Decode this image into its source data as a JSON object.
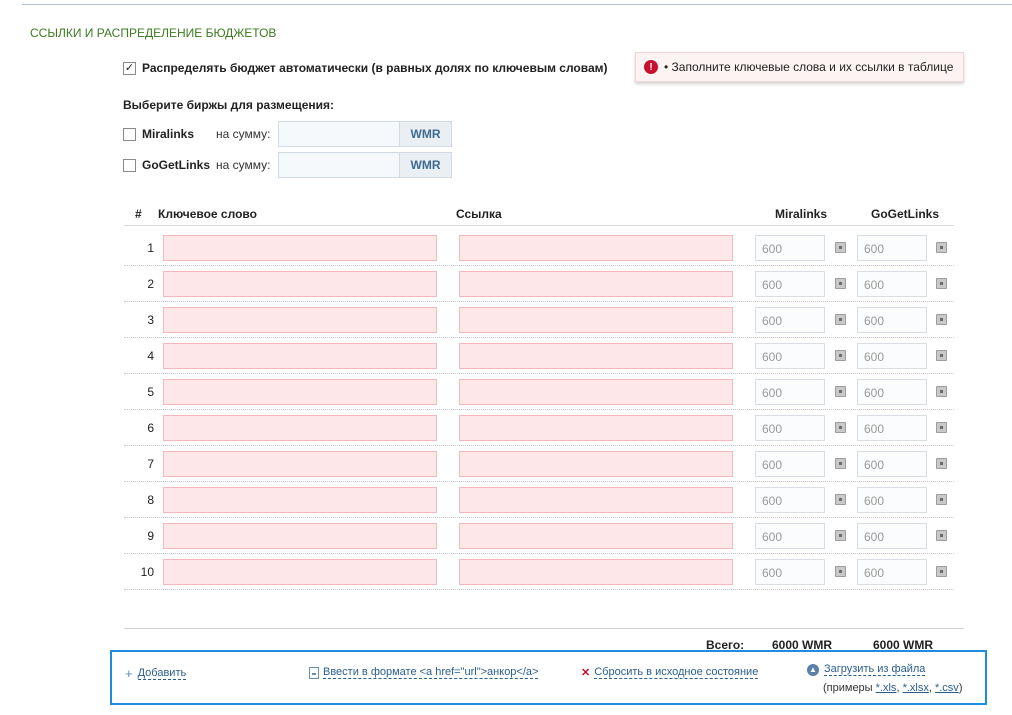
{
  "section": {
    "title": "ССЫЛКИ И РАСПРЕДЕЛЕНИЕ БЮДЖЕТОВ"
  },
  "auto_distribute": {
    "label": "Распределять бюджет автоматически (в равных долях по ключевым словам)",
    "checked": true,
    "check_glyph": "✓"
  },
  "alert": {
    "icon": "!",
    "text": "• Заполните ключевые слова и их ссылки в таблице"
  },
  "exchanges": {
    "title": "Выберите биржы для размещения:",
    "items": [
      {
        "name": "Miralinks",
        "sum_label": "на сумму:",
        "currency": "WMR",
        "value": ""
      },
      {
        "name": "GoGetLinks",
        "sum_label": "на сумму:",
        "currency": "WMR",
        "value": ""
      }
    ]
  },
  "table": {
    "headers": {
      "num": "#",
      "keyword": "Ключевое слово",
      "link": "Ссылка",
      "miralinks": "Miralinks",
      "gogetlinks": "GoGetLinks"
    },
    "rows": [
      {
        "num": "1",
        "keyword": "",
        "link": "",
        "miralinks": "600",
        "gogetlinks": "600"
      },
      {
        "num": "2",
        "keyword": "",
        "link": "",
        "miralinks": "600",
        "gogetlinks": "600"
      },
      {
        "num": "3",
        "keyword": "",
        "link": "",
        "miralinks": "600",
        "gogetlinks": "600"
      },
      {
        "num": "4",
        "keyword": "",
        "link": "",
        "miralinks": "600",
        "gogetlinks": "600"
      },
      {
        "num": "5",
        "keyword": "",
        "link": "",
        "miralinks": "600",
        "gogetlinks": "600"
      },
      {
        "num": "6",
        "keyword": "",
        "link": "",
        "miralinks": "600",
        "gogetlinks": "600"
      },
      {
        "num": "7",
        "keyword": "",
        "link": "",
        "miralinks": "600",
        "gogetlinks": "600"
      },
      {
        "num": "8",
        "keyword": "",
        "link": "",
        "miralinks": "600",
        "gogetlinks": "600"
      },
      {
        "num": "9",
        "keyword": "",
        "link": "",
        "miralinks": "600",
        "gogetlinks": "600"
      },
      {
        "num": "10",
        "keyword": "",
        "link": "",
        "miralinks": "600",
        "gogetlinks": "600"
      }
    ],
    "totals": {
      "label": "Всего:",
      "miralinks": "6000 WMR",
      "gogetlinks": "6000 WMR"
    }
  },
  "actions": {
    "add": "Добавить",
    "enter_format": "Ввести в формате <a href=\"url\">анкор</a>",
    "reset": "Сбросить в исходное состояние",
    "upload": "Загрузить из файла",
    "examples_prefix": "(примеры",
    "examples": [
      "*.xls",
      "*.xlsx",
      "*.csv"
    ],
    "examples_suffix": ")"
  },
  "colors": {
    "section_title": "#3b7a20",
    "alert_icon": "#c8102e",
    "action_link": "#2a5d8e",
    "highlight_border": "#1e8de0"
  }
}
